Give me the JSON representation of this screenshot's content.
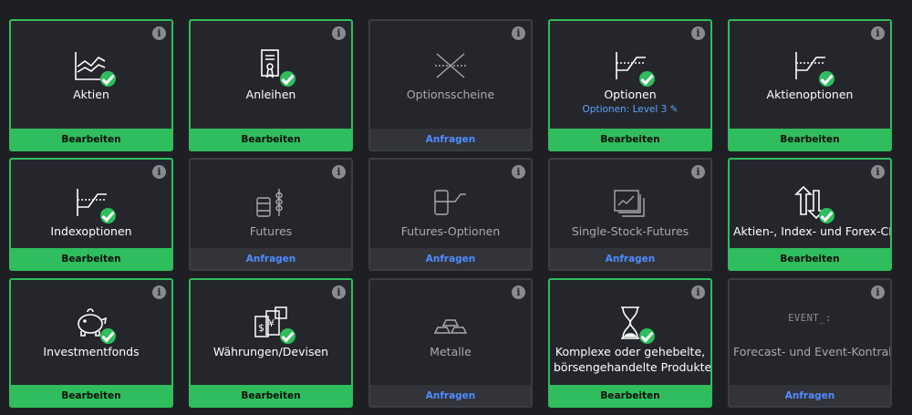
{
  "colors": {
    "accent_green": "#2fbd5d",
    "request_blue": "#4f8dff",
    "background": "#1e1f23",
    "tile": "#25262b"
  },
  "tiles": [
    {
      "label": "Aktien",
      "action": "Bearbeiten",
      "icon": "stock-chart-icon",
      "status": "active"
    },
    {
      "label": "Anleihen",
      "action": "Bearbeiten",
      "icon": "certificate-icon",
      "status": "active"
    },
    {
      "label": "Optionsscheine",
      "action": "Anfragen",
      "icon": "crossed-lines-icon",
      "status": "inactive"
    },
    {
      "label": "Optionen",
      "sublabel": "Optionen: Level 3",
      "action": "Bearbeiten",
      "icon": "option-payoff-icon",
      "status": "active"
    },
    {
      "label": "Aktienoptionen",
      "action": "Bearbeiten",
      "icon": "option-payoff-icon",
      "status": "active"
    },
    {
      "label": "Indexoptionen",
      "action": "Bearbeiten",
      "icon": "option-payoff-icon",
      "status": "active"
    },
    {
      "label": "Futures",
      "action": "Anfragen",
      "icon": "barrel-wheat-icon",
      "status": "inactive"
    },
    {
      "label": "Futures-Optionen",
      "action": "Anfragen",
      "icon": "barrel-payoff-icon",
      "status": "inactive"
    },
    {
      "label": "Single-Stock-Futures",
      "action": "Anfragen",
      "icon": "stacked-charts-icon",
      "status": "inactive"
    },
    {
      "label": "Aktien-, Index- und Forex-CFDs",
      "action": "Bearbeiten",
      "icon": "arrows-exchange-icon",
      "status": "active"
    },
    {
      "label": "Investmentfonds",
      "action": "Bearbeiten",
      "icon": "piggy-bank-icon",
      "status": "active"
    },
    {
      "label": "Währungen/Devisen",
      "action": "Bearbeiten",
      "icon": "currency-notes-icon",
      "status": "active"
    },
    {
      "label": "Metalle",
      "action": "Anfragen",
      "icon": "gold-bars-icon",
      "status": "inactive"
    },
    {
      "label": "Komplexe oder gehebelte,",
      "label2": "börsengehandelte Produkte",
      "action": "Bearbeiten",
      "icon": "hourglass-icon",
      "status": "active"
    },
    {
      "label": "Forecast- und Event-Kontrakte",
      "icon_text": "EVENT_:",
      "action": "Anfragen",
      "icon": "event-text-icon",
      "status": "inactive"
    }
  ]
}
